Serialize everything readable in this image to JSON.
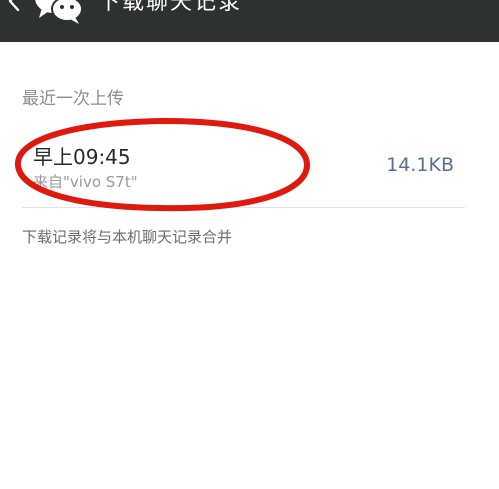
{
  "header": {
    "back_icon": "chevron-left-icon",
    "logo_icon": "wechat-logo-icon",
    "title": "下载聊天记录",
    "background_color": "#2e3132"
  },
  "section": {
    "header": "最近一次上传"
  },
  "record": {
    "time": "早上09:45",
    "source": "来自\"vivo S7t\"",
    "size": "14.1KB",
    "size_color": "#5b7090"
  },
  "footer": {
    "note": "下载记录将与本机聊天记录合并"
  },
  "annotation": {
    "color": "#e0190f"
  }
}
